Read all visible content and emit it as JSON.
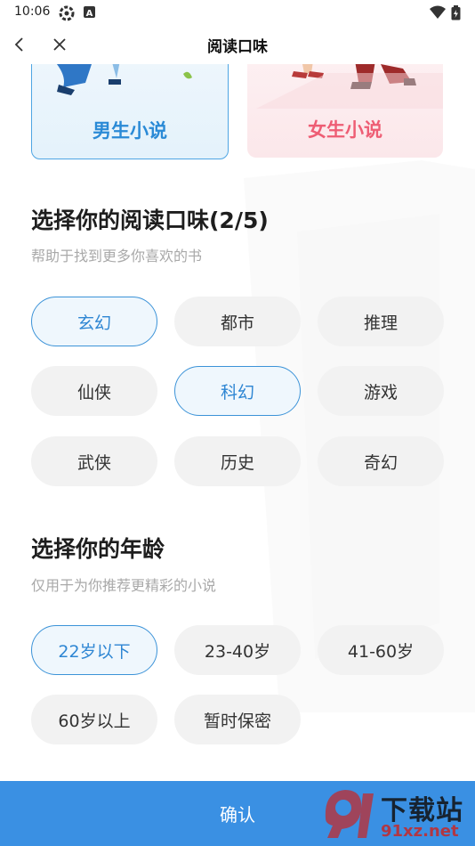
{
  "status_bar": {
    "time": "10:06"
  },
  "nav": {
    "title": "阅读口味"
  },
  "gender_cards": [
    {
      "label": "男生小说",
      "selected": true
    },
    {
      "label": "女生小说",
      "selected": false
    }
  ],
  "taste_section": {
    "title": "选择你的阅读口味(2/5)",
    "subtitle": "帮助于找到更多你喜欢的书",
    "options": [
      {
        "label": "玄幻",
        "selected": true
      },
      {
        "label": "都市",
        "selected": false
      },
      {
        "label": "推理",
        "selected": false
      },
      {
        "label": "仙侠",
        "selected": false
      },
      {
        "label": "科幻",
        "selected": true
      },
      {
        "label": "游戏",
        "selected": false
      },
      {
        "label": "武侠",
        "selected": false
      },
      {
        "label": "历史",
        "selected": false
      },
      {
        "label": "奇幻",
        "selected": false
      }
    ]
  },
  "age_section": {
    "title": "选择你的年龄",
    "subtitle": "仅用于为你推荐更精彩的小说",
    "options": [
      {
        "label": "22岁以下",
        "selected": true
      },
      {
        "label": "23-40岁",
        "selected": false
      },
      {
        "label": "41-60岁",
        "selected": false
      },
      {
        "label": "60岁以上",
        "selected": false
      },
      {
        "label": "暂时保密",
        "selected": false
      }
    ]
  },
  "confirm": {
    "label": "确认"
  },
  "watermark": {
    "line1": "下载站",
    "line2": "91xz.net"
  },
  "colors": {
    "accent": "#3a90e3",
    "chip_bg": "#f2f2f2",
    "female": "#ee5d74"
  },
  "icons": [
    "settings-gear-icon",
    "accessibility-a-icon",
    "wifi-icon",
    "battery-icon",
    "back-arrow-icon",
    "close-icon"
  ]
}
